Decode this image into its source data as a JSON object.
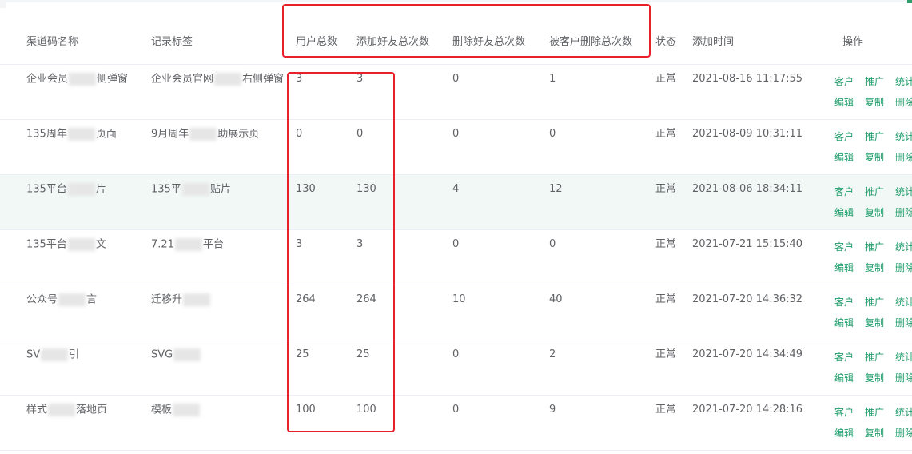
{
  "headers": {
    "channel_name": "渠道码名称",
    "record_tag": "记录标签",
    "user_total": "用户总数",
    "add_friend_total": "添加好友总次数",
    "delete_friend_total": "删除好友总次数",
    "deleted_by_customer_total": "被客户删除总次数",
    "status": "状态",
    "add_time": "添加时间",
    "actions": "操作"
  },
  "actions": {
    "customer": "客户",
    "promote": "推广",
    "stats": "统计",
    "edit": "编辑",
    "copy": "复制",
    "delete": "删除"
  },
  "rows": [
    {
      "name_a": "企业会员",
      "name_b": "侧弹窗",
      "tag_a": "企业会员官网",
      "tag_b": "右侧弹窗",
      "users": "3",
      "adds": "3",
      "deletes": "0",
      "deleted_by": "1",
      "status": "正常",
      "time": "2021-08-16 11:17:55"
    },
    {
      "name_a": "135周年",
      "name_b": "页面",
      "tag_a": "9月周年",
      "tag_b": "助展示页",
      "users": "0",
      "adds": "0",
      "deletes": "0",
      "deleted_by": "0",
      "status": "正常",
      "time": "2021-08-09 10:31:11"
    },
    {
      "name_a": "135平台",
      "name_b": "片",
      "tag_a": "135平",
      "tag_b": "贴片",
      "users": "130",
      "adds": "130",
      "deletes": "4",
      "deleted_by": "12",
      "status": "正常",
      "time": "2021-08-06 18:34:11"
    },
    {
      "name_a": "135平台",
      "name_b": "文",
      "tag_a": "7.21",
      "tag_b": "平台",
      "users": "3",
      "adds": "3",
      "deletes": "0",
      "deleted_by": "0",
      "status": "正常",
      "time": "2021-07-21 15:15:40"
    },
    {
      "name_a": "公众号",
      "name_b": "言",
      "tag_a": "迁移升",
      "tag_b": "",
      "users": "264",
      "adds": "264",
      "deletes": "10",
      "deleted_by": "40",
      "status": "正常",
      "time": "2021-07-20 14:36:32"
    },
    {
      "name_a": "SV",
      "name_b": "引",
      "tag_a": "SVG",
      "tag_b": "",
      "users": "25",
      "adds": "25",
      "deletes": "0",
      "deleted_by": "2",
      "status": "正常",
      "time": "2021-07-20 14:34:49"
    },
    {
      "name_a": "样式",
      "name_b": "落地页",
      "tag_a": "模板",
      "tag_b": "",
      "users": "100",
      "adds": "100",
      "deletes": "0",
      "deleted_by": "9",
      "status": "正常",
      "time": "2021-07-20 14:28:16"
    }
  ],
  "colors": {
    "accent": "#1f9d6b",
    "annotation": "#e8202a",
    "highlight_row": "#f2f8f6"
  }
}
